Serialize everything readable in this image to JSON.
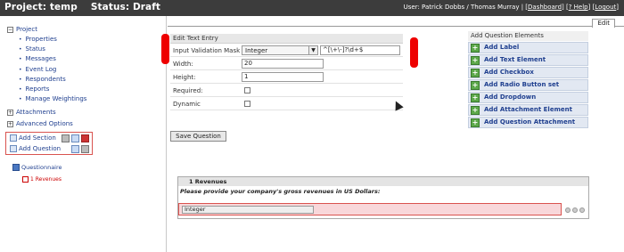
{
  "header": {
    "project_label": "Project:",
    "project_name": "temp",
    "status_label": "Status:",
    "status_value": "Draft",
    "user_prefix": "User: Patrick Dobbs / Thomas Murray",
    "dashboard": "Dashboard",
    "help": "? Help",
    "logout": "Logout"
  },
  "sidebar": {
    "project": "Project",
    "items": [
      "Properties",
      "Status",
      "Messages",
      "Event Log",
      "Respondents",
      "Reports",
      "Manage Weightings"
    ],
    "attachments": "Attachments",
    "advanced": "Advanced Options",
    "add_section": "Add Section",
    "add_question": "Add Question",
    "questionnaire": "Questionnaire",
    "revenues": "1 Revenues"
  },
  "tabs": {
    "edit": "Edit"
  },
  "form": {
    "title": "Edit Text Entry",
    "mask_label": "Input Validation Mask",
    "mask_select": "Integer",
    "mask_value": "^[\\+\\-]?\\d+$",
    "width_label": "Width:",
    "width_value": "20",
    "height_label": "Height:",
    "height_value": "1",
    "required_label": "Required:",
    "dynamic_label": "Dynamic",
    "save": "Save Question"
  },
  "qpanel": {
    "title": "Add Question Elements",
    "buttons": [
      "Add Label",
      "Add Text Element",
      "Add Checkbox",
      "Add Radio Button set",
      "Add Dropdown",
      "Add Attachment Element",
      "Add Question Attachment"
    ]
  },
  "preview": {
    "header": "1 Revenues",
    "question": "Please provide your company's gross revenues in US Dollars:",
    "answer": "Integer"
  }
}
